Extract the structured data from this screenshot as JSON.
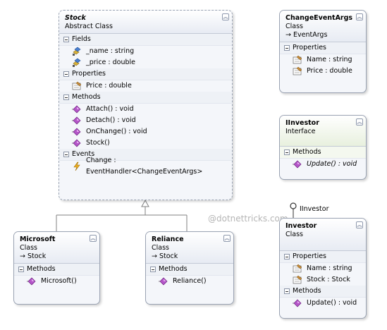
{
  "watermark": "@dotnettricks.com",
  "stock": {
    "title": "Stock",
    "subtitle": "Abstract Class",
    "fields_header": "Fields",
    "fields": [
      "_name : string",
      "_price : double"
    ],
    "properties_header": "Properties",
    "properties": [
      "Price : double"
    ],
    "methods_header": "Methods",
    "methods": [
      "Attach() : void",
      "Detach() : void",
      "OnChange() : void",
      "Stock()"
    ],
    "events_header": "Events",
    "events": [
      "Change : EventHandler<ChangeEventArgs>"
    ]
  },
  "change_event_args": {
    "title": "ChangeEventArgs",
    "subtitle": "Class",
    "base": "→ EventArgs",
    "properties_header": "Properties",
    "properties": [
      "Name : string",
      "Price : double"
    ]
  },
  "iinvestor": {
    "title": "IInvestor",
    "subtitle": "Interface",
    "methods_header": "Methods",
    "methods": [
      "Update() : void"
    ]
  },
  "investor": {
    "lollipop_label": "IInvestor",
    "title": "Investor",
    "subtitle": "Class",
    "properties_header": "Properties",
    "properties": [
      "Name : string",
      "Stock : Stock"
    ],
    "methods_header": "Methods",
    "methods": [
      "Update() : void"
    ]
  },
  "microsoft": {
    "title": "Microsoft",
    "subtitle": "Class",
    "base": "→ Stock",
    "methods_header": "Methods",
    "methods": [
      "Microsoft()"
    ]
  },
  "reliance": {
    "title": "Reliance",
    "subtitle": "Class",
    "base": "→ Stock",
    "methods_header": "Methods",
    "methods": [
      "Reliance()"
    ]
  },
  "collapse_glyph": "︽"
}
